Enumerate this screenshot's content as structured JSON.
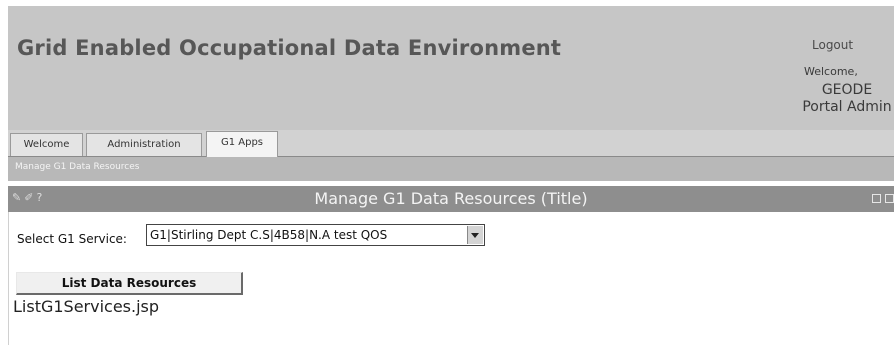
{
  "header": {
    "title": "Grid Enabled Occupational Data Environment",
    "logout_label": "Logout",
    "welcome_label": "Welcome,",
    "user_line1": "GEODE",
    "user_line2": "Portal Admin"
  },
  "tabs": [
    {
      "label": "Welcome",
      "active": false
    },
    {
      "label": "Administration",
      "active": false
    },
    {
      "label": "G1 Apps",
      "active": true
    }
  ],
  "subnav": {
    "item": "Manage G1 Data Resources"
  },
  "portlet": {
    "title": "Manage G1 Data Resources (Title)",
    "icons": [
      "edit-icon",
      "pencil-icon",
      "help-icon"
    ],
    "icon_glyphs": [
      "✎",
      "✐",
      "?"
    ],
    "controls": [
      "minimize-icon",
      "maximize-icon"
    ]
  },
  "form": {
    "select_label": "Select G1 Service:",
    "select_value": "G1|Stirling Dept C.S|4B58|N.A test QOS",
    "button_label": "List Data Resources"
  },
  "output_text": "ListG1Services.jsp",
  "colors": {
    "header_bg": "#c6c6c6",
    "title_text": "#575757",
    "subnav_bg": "#b8b8b8",
    "portlet_bar_bg": "#8e8e8e"
  }
}
